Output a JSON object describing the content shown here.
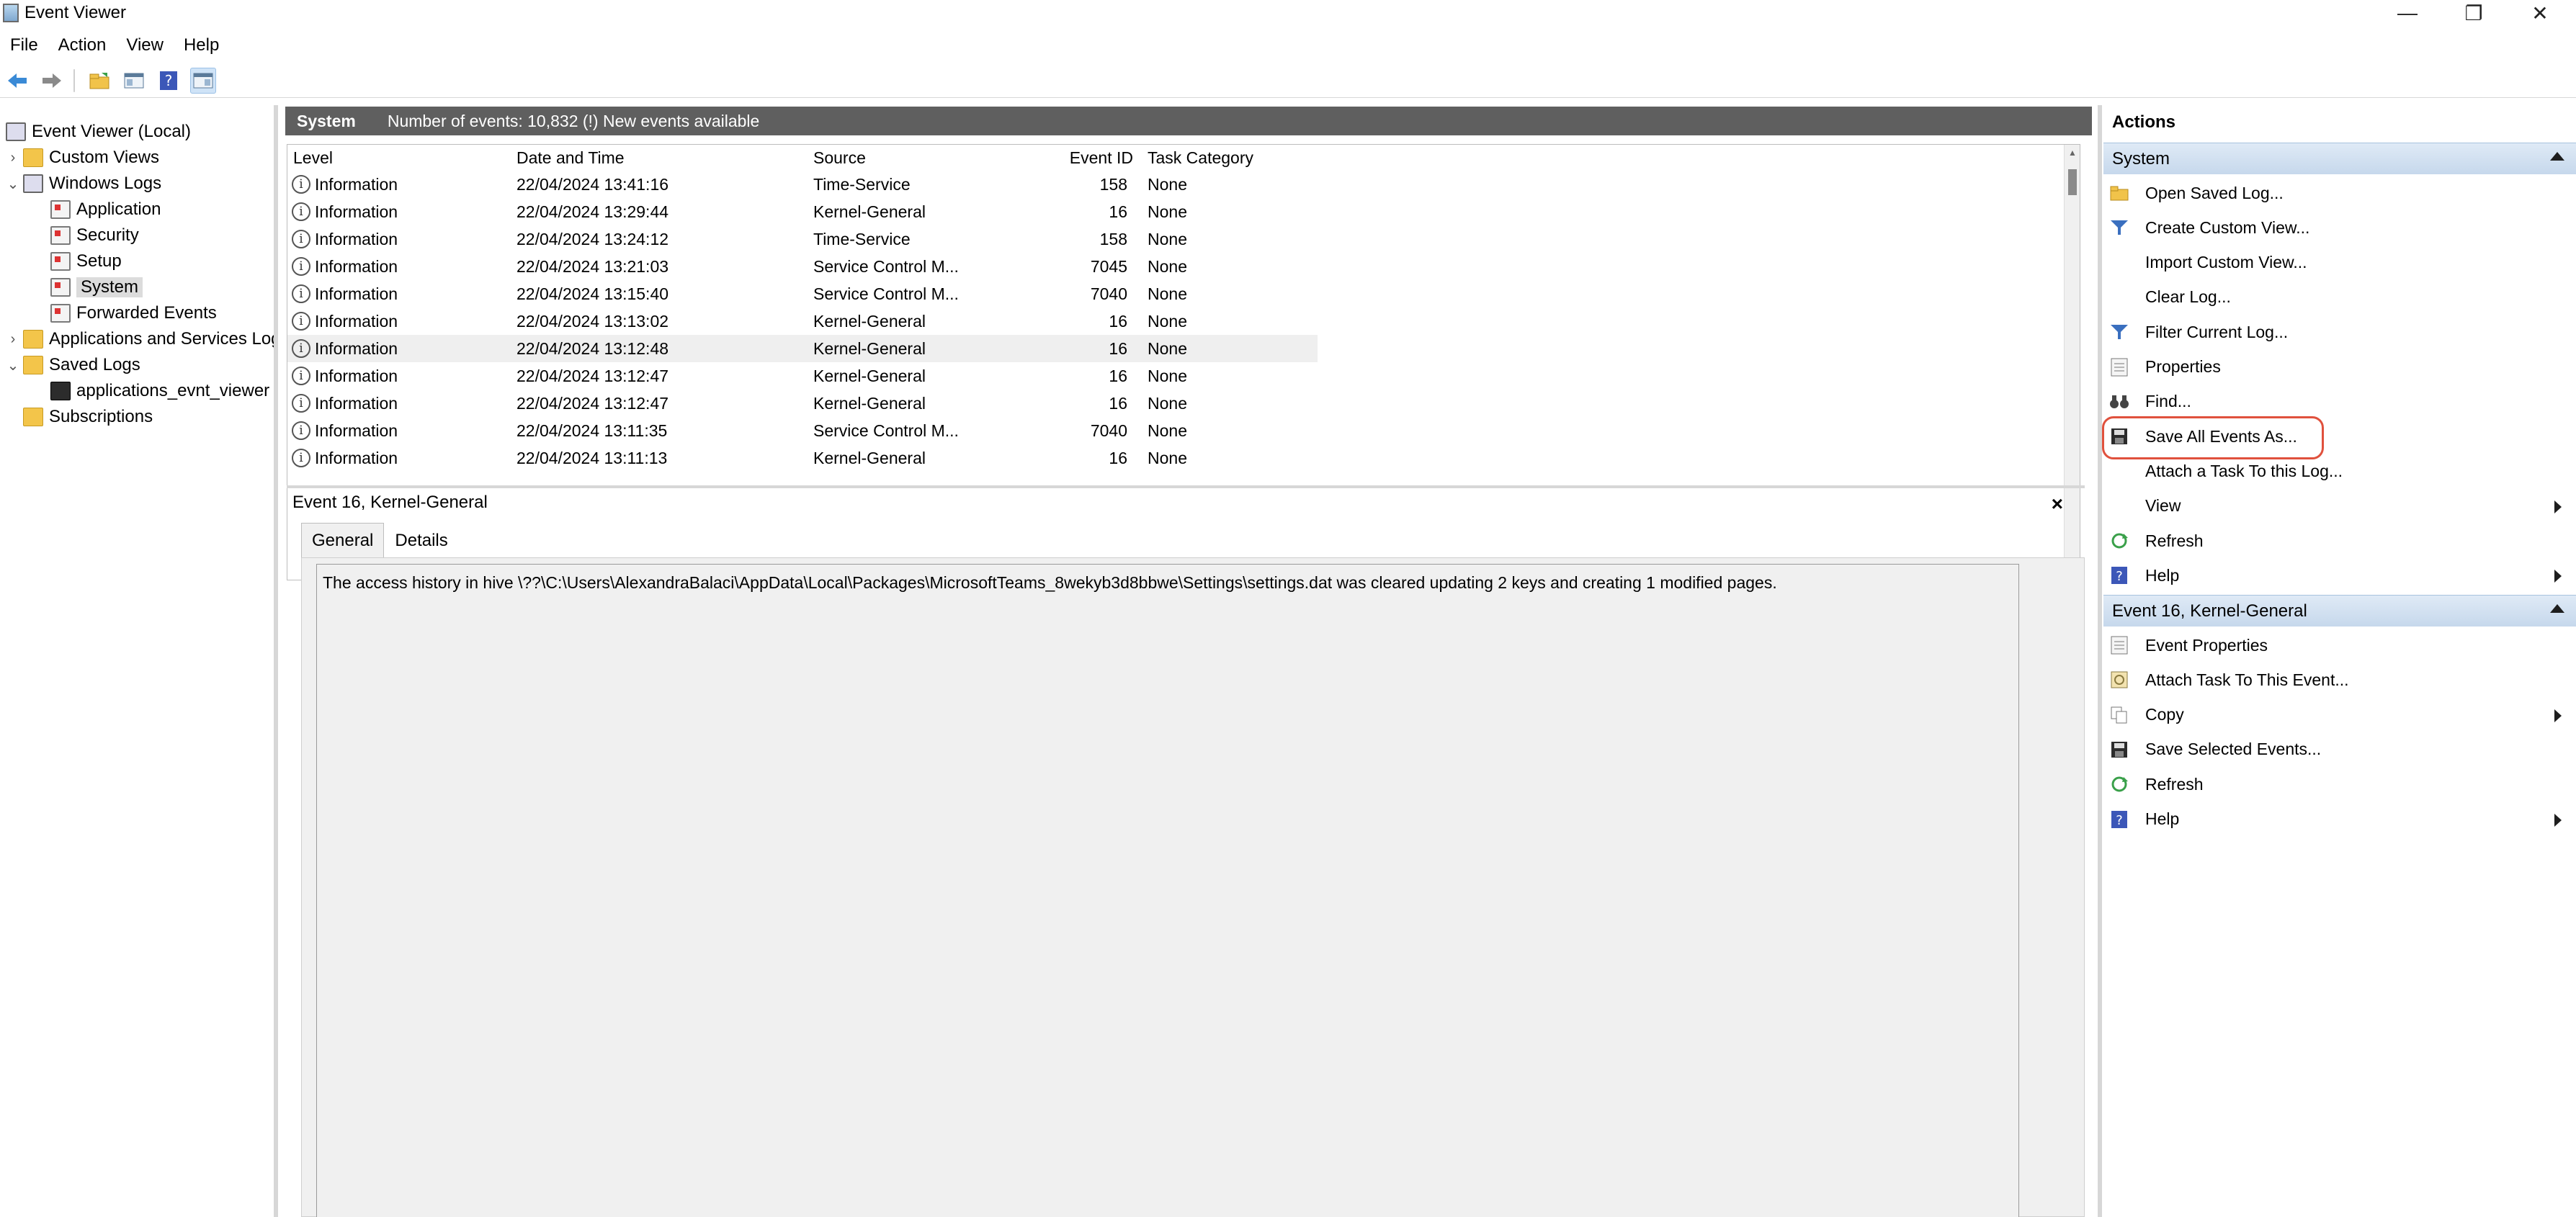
{
  "window": {
    "title": "Event Viewer"
  },
  "menu": [
    "File",
    "Action",
    "View",
    "Help"
  ],
  "toolbar_icons": [
    "back-icon",
    "forward-icon",
    "open-folder-icon",
    "show-hide-icon",
    "help-icon",
    "action-pane-icon"
  ],
  "tree": [
    {
      "label": "Event Viewer (Local)",
      "level": 0,
      "icon": "viewer",
      "expander": ""
    },
    {
      "label": "Custom Views",
      "level": 1,
      "icon": "folder",
      "expander": "›"
    },
    {
      "label": "Windows Logs",
      "level": 1,
      "icon": "viewer",
      "expander": "⌄"
    },
    {
      "label": "Application",
      "level": 2,
      "icon": "log",
      "expander": ""
    },
    {
      "label": "Security",
      "level": 2,
      "icon": "log",
      "expander": ""
    },
    {
      "label": "Setup",
      "level": 2,
      "icon": "log",
      "expander": ""
    },
    {
      "label": "System",
      "level": 2,
      "icon": "log",
      "expander": "",
      "selected": true
    },
    {
      "label": "Forwarded Events",
      "level": 2,
      "icon": "log",
      "expander": ""
    },
    {
      "label": "Applications and Services Log",
      "level": 1,
      "icon": "folder",
      "expander": "›"
    },
    {
      "label": "Saved Logs",
      "level": 1,
      "icon": "folder",
      "expander": "⌄"
    },
    {
      "label": "applications_evnt_viewer",
      "level": 2,
      "icon": "disk",
      "expander": ""
    },
    {
      "label": "Subscriptions",
      "level": 1,
      "icon": "subs",
      "expander": ""
    }
  ],
  "center": {
    "log_name": "System",
    "event_count": "Number of events: 10,832 (!) New events available",
    "columns": [
      "Level",
      "Date and Time",
      "Source",
      "Event ID",
      "Task Category"
    ],
    "rows": [
      {
        "level": "Information",
        "datetime": "22/04/2024 13:41:16",
        "source": "Time-Service",
        "id": "158",
        "category": "None"
      },
      {
        "level": "Information",
        "datetime": "22/04/2024 13:29:44",
        "source": "Kernel-General",
        "id": "16",
        "category": "None"
      },
      {
        "level": "Information",
        "datetime": "22/04/2024 13:24:12",
        "source": "Time-Service",
        "id": "158",
        "category": "None"
      },
      {
        "level": "Information",
        "datetime": "22/04/2024 13:21:03",
        "source": "Service Control M...",
        "id": "7045",
        "category": "None"
      },
      {
        "level": "Information",
        "datetime": "22/04/2024 13:15:40",
        "source": "Service Control M...",
        "id": "7040",
        "category": "None"
      },
      {
        "level": "Information",
        "datetime": "22/04/2024 13:13:02",
        "source": "Kernel-General",
        "id": "16",
        "category": "None"
      },
      {
        "level": "Information",
        "datetime": "22/04/2024 13:12:48",
        "source": "Kernel-General",
        "id": "16",
        "category": "None",
        "selected": true
      },
      {
        "level": "Information",
        "datetime": "22/04/2024 13:12:47",
        "source": "Kernel-General",
        "id": "16",
        "category": "None"
      },
      {
        "level": "Information",
        "datetime": "22/04/2024 13:12:47",
        "source": "Kernel-General",
        "id": "16",
        "category": "None"
      },
      {
        "level": "Information",
        "datetime": "22/04/2024 13:11:35",
        "source": "Service Control M...",
        "id": "7040",
        "category": "None"
      },
      {
        "level": "Information",
        "datetime": "22/04/2024 13:11:13",
        "source": "Kernel-General",
        "id": "16",
        "category": "None"
      }
    ],
    "detail": {
      "title": "Event 16, Kernel-General",
      "close": "×",
      "tabs": [
        "General",
        "Details"
      ],
      "message": "The access history in hive \\??\\C:\\Users\\AlexandraBalaci\\AppData\\Local\\Packages\\MicrosoftTeams_8wekyb3d8bbwe\\Settings\\settings.dat was cleared updating 2 keys and creating 1 modified pages."
    }
  },
  "actions": {
    "title": "Actions",
    "groups": [
      {
        "name": "System",
        "items": [
          {
            "label": "Open Saved Log...",
            "icon": "open-folder-icon"
          },
          {
            "label": "Create Custom View...",
            "icon": "filter-icon"
          },
          {
            "label": "Import Custom View...",
            "icon": ""
          },
          {
            "label": "Clear Log...",
            "icon": ""
          },
          {
            "label": "Filter Current Log...",
            "icon": "filter-icon"
          },
          {
            "label": "Properties",
            "icon": "properties-icon"
          },
          {
            "label": "Find...",
            "icon": "binoculars-icon"
          },
          {
            "label": "Save All Events As...",
            "icon": "save-icon"
          },
          {
            "label": "Attach a Task To this Log...",
            "icon": ""
          },
          {
            "label": "View",
            "icon": "",
            "submenu": true
          },
          {
            "label": "Refresh",
            "icon": "refresh-icon"
          },
          {
            "label": "Help",
            "icon": "help-icon",
            "submenu": true
          }
        ]
      },
      {
        "name": "Event 16, Kernel-General",
        "items": [
          {
            "label": "Event Properties",
            "icon": "properties-icon"
          },
          {
            "label": "Attach Task To This Event...",
            "icon": "task-icon"
          },
          {
            "label": "Copy",
            "icon": "copy-icon",
            "submenu": true
          },
          {
            "label": "Save Selected Events...",
            "icon": "save-icon"
          },
          {
            "label": "Refresh",
            "icon": "refresh-icon"
          },
          {
            "label": "Help",
            "icon": "help-icon",
            "submenu": true
          }
        ]
      }
    ]
  },
  "colors": {
    "header_band": "#5f5f5f",
    "highlight": "#e0513d",
    "group_band": "#c6d8ec"
  }
}
